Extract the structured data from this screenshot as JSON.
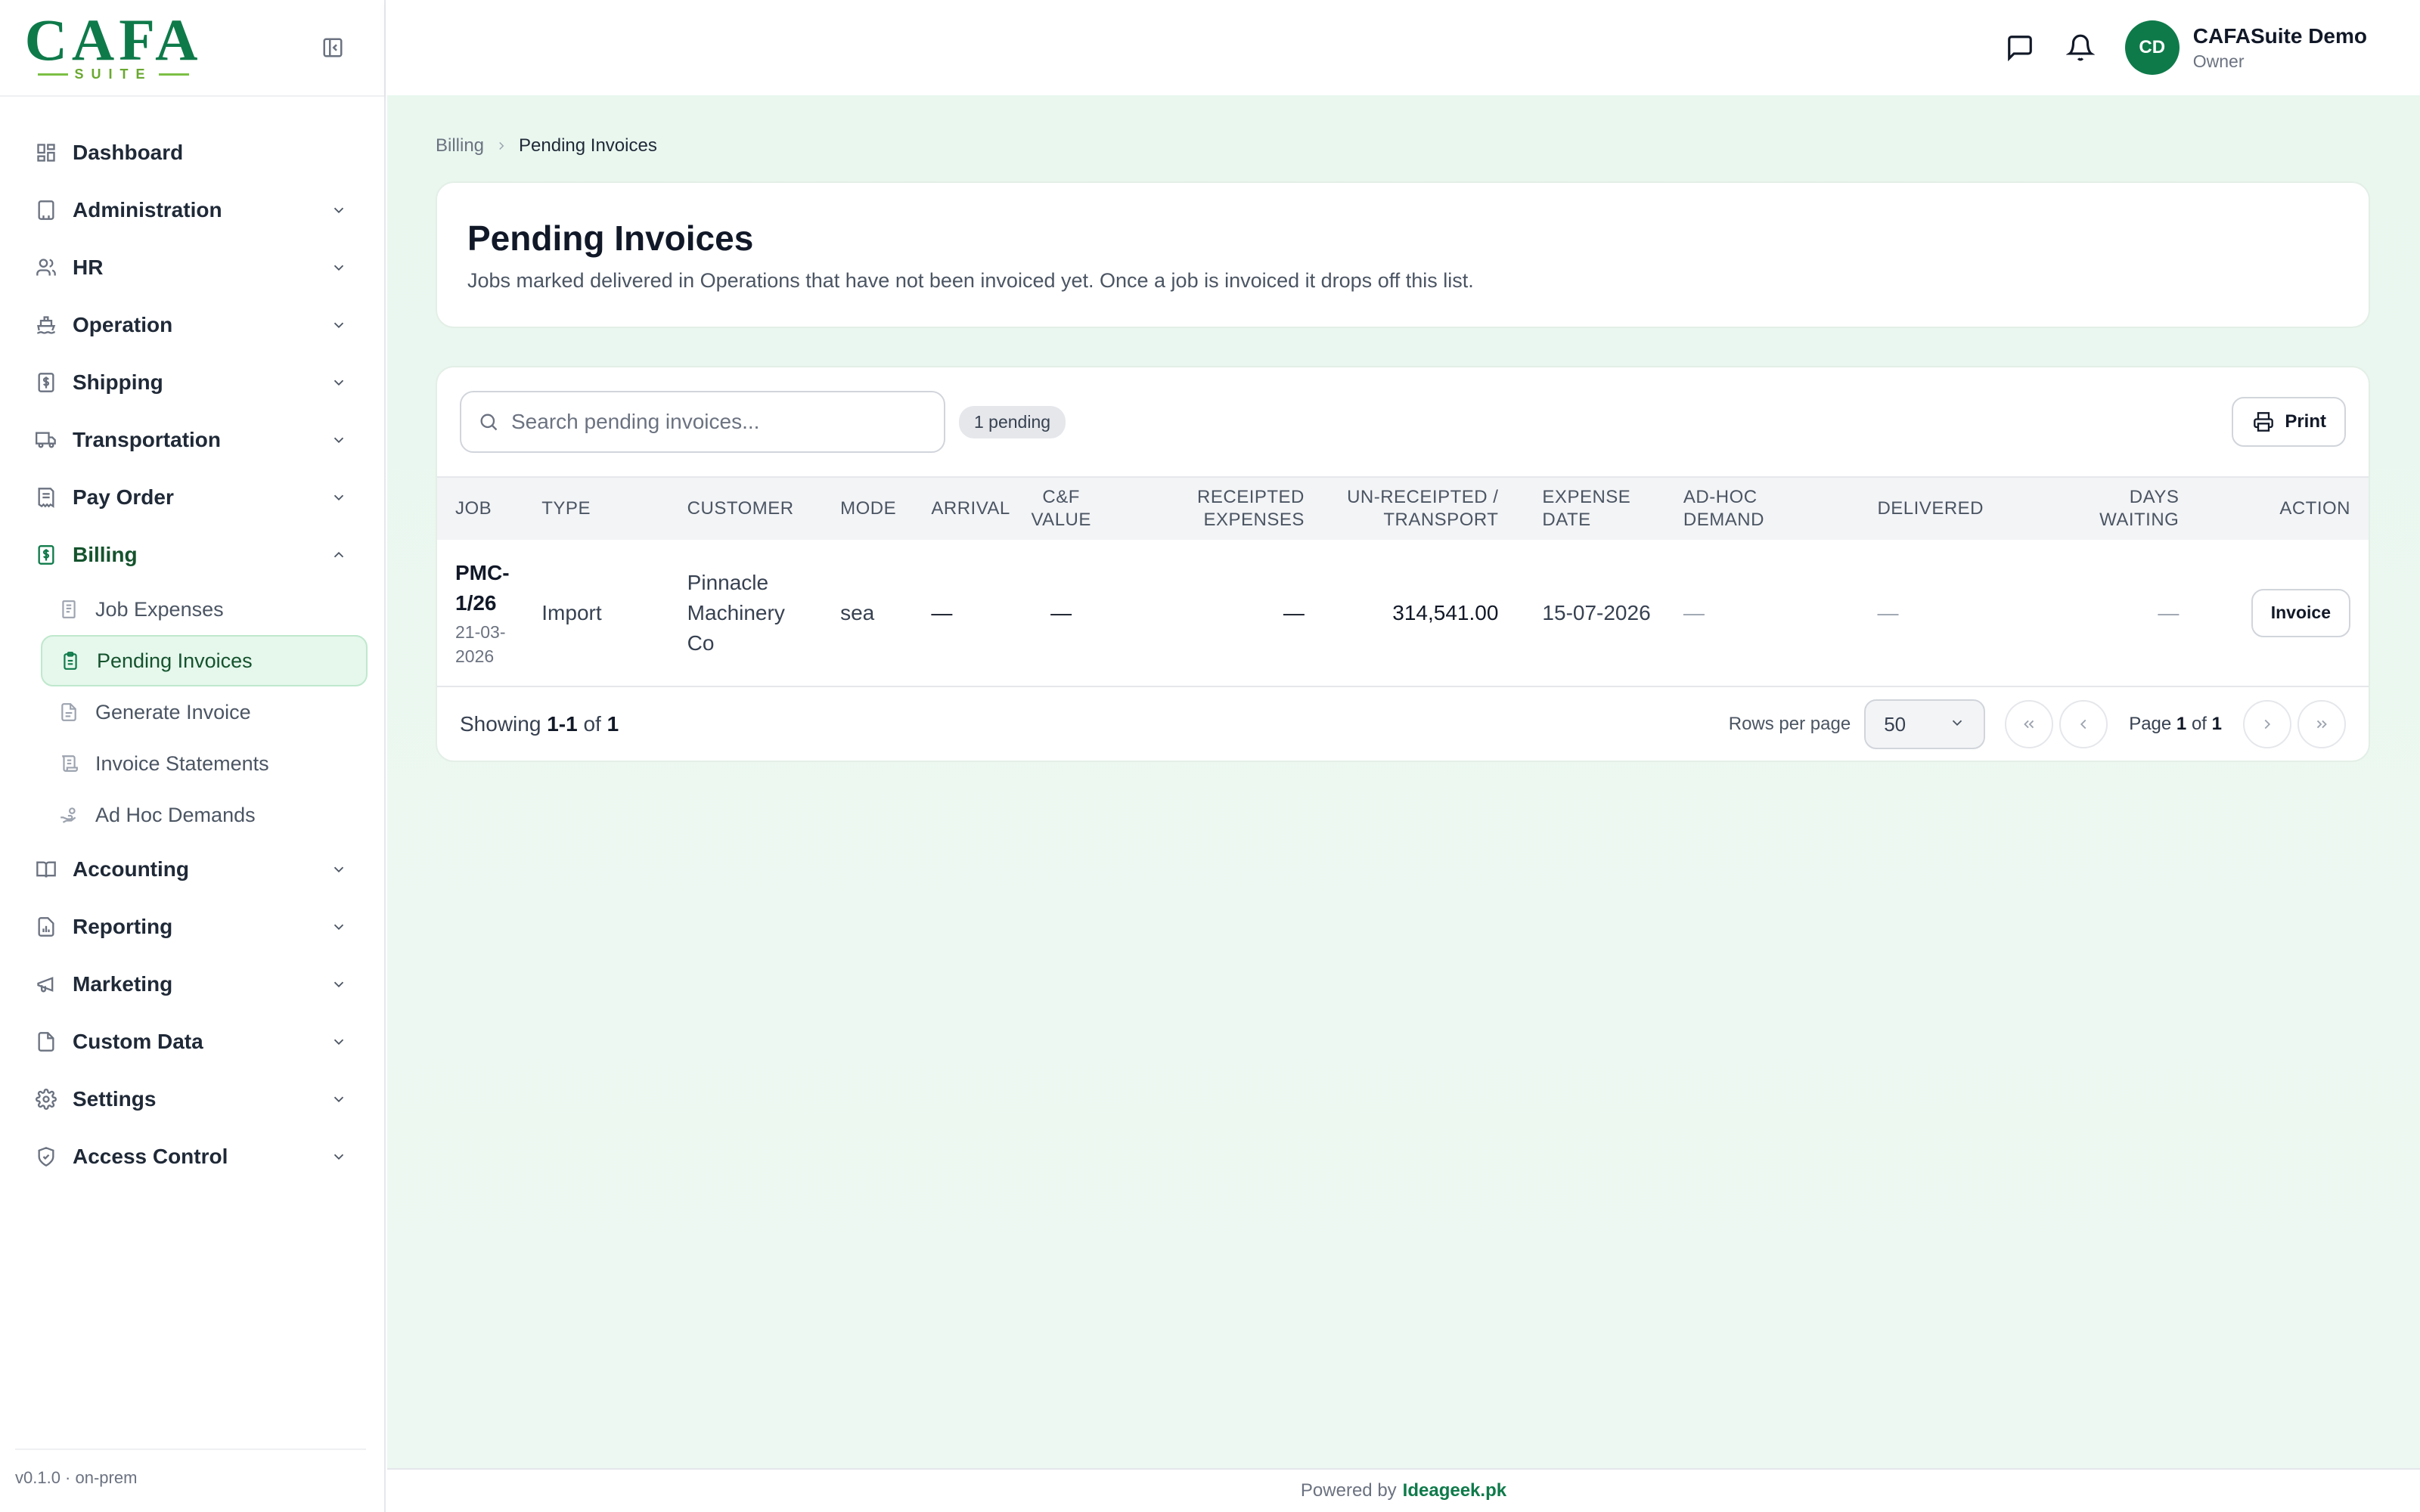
{
  "brand": {
    "logo_text": "CAFA",
    "logo_sub": "SUITE",
    "accent": "#0e7a4a"
  },
  "sidebar": {
    "items": [
      {
        "label": "Dashboard",
        "icon": "dashboard-icon"
      },
      {
        "label": "Administration",
        "icon": "building-icon"
      },
      {
        "label": "HR",
        "icon": "users-icon"
      },
      {
        "label": "Operation",
        "icon": "ship-icon"
      },
      {
        "label": "Shipping",
        "icon": "dollar-doc-icon"
      },
      {
        "label": "Transportation",
        "icon": "truck-icon"
      },
      {
        "label": "Pay Order",
        "icon": "receipt-icon"
      },
      {
        "label": "Billing",
        "icon": "billing-icon"
      },
      {
        "label": "Accounting",
        "icon": "book-icon"
      },
      {
        "label": "Reporting",
        "icon": "report-icon"
      },
      {
        "label": "Marketing",
        "icon": "megaphone-icon"
      },
      {
        "label": "Custom Data",
        "icon": "file-icon"
      },
      {
        "label": "Settings",
        "icon": "gear-icon"
      },
      {
        "label": "Access Control",
        "icon": "shield-icon"
      }
    ],
    "billing_sub": [
      {
        "label": "Job Expenses"
      },
      {
        "label": "Pending Invoices"
      },
      {
        "label": "Generate Invoice"
      },
      {
        "label": "Invoice Statements"
      },
      {
        "label": "Ad Hoc Demands"
      }
    ],
    "version": "v0.1.0 · on-prem"
  },
  "topbar": {
    "user_name": "CAFASuite Demo",
    "user_role": "Owner",
    "avatar_initials": "CD"
  },
  "breadcrumb": {
    "parent": "Billing",
    "current": "Pending Invoices"
  },
  "header": {
    "title": "Pending Invoices",
    "description": "Jobs marked delivered in Operations that have not been invoiced yet. Once a job is invoiced it drops off this list."
  },
  "toolbar": {
    "search_placeholder": "Search pending invoices...",
    "badge": "1 pending",
    "print_label": "Print"
  },
  "table": {
    "columns": {
      "job": "Job",
      "type": "Type",
      "customer": "Customer",
      "mode": "Mode",
      "arrival": "Arrival",
      "cf_value_1": "C&F",
      "cf_value_2": "Value",
      "receipted_1": "Receipted",
      "receipted_2": "Expenses",
      "unreceipted_1": "Un-Receipted /",
      "unreceipted_2": "Transport",
      "expense_date": "Expense Date",
      "adhoc_1": "Ad-Hoc",
      "adhoc_2": "Demand",
      "delivered": "Delivered",
      "days_waiting": "Days Waiting",
      "action": "Action"
    },
    "rows": [
      {
        "job_line1": "PMC-",
        "job_line2": "1/26",
        "date_line1": "21-03-",
        "date_line2": "2026",
        "type": "Import",
        "customer_line1": "Pinnacle",
        "customer_line2": "Machinery",
        "customer_line3": "Co",
        "mode": "sea",
        "arrival": "—",
        "cf_value": "—",
        "receipted": "—",
        "unreceipted": "314,541.00",
        "expense_date": "15-07-2026",
        "adhoc": "—",
        "delivered": "—",
        "days_waiting": "—",
        "action": "Invoice"
      }
    ]
  },
  "pagination": {
    "showing_prefix": "Showing",
    "showing_range": "1-1",
    "showing_of": "of",
    "showing_total": "1",
    "rows_per_page_label": "Rows per page",
    "rows_per_page": "50",
    "page_prefix": "Page",
    "page_current": "1",
    "page_of": "of",
    "page_total": "1"
  },
  "footer": {
    "powered_by": "Powered by",
    "company": "Ideageek.pk"
  }
}
